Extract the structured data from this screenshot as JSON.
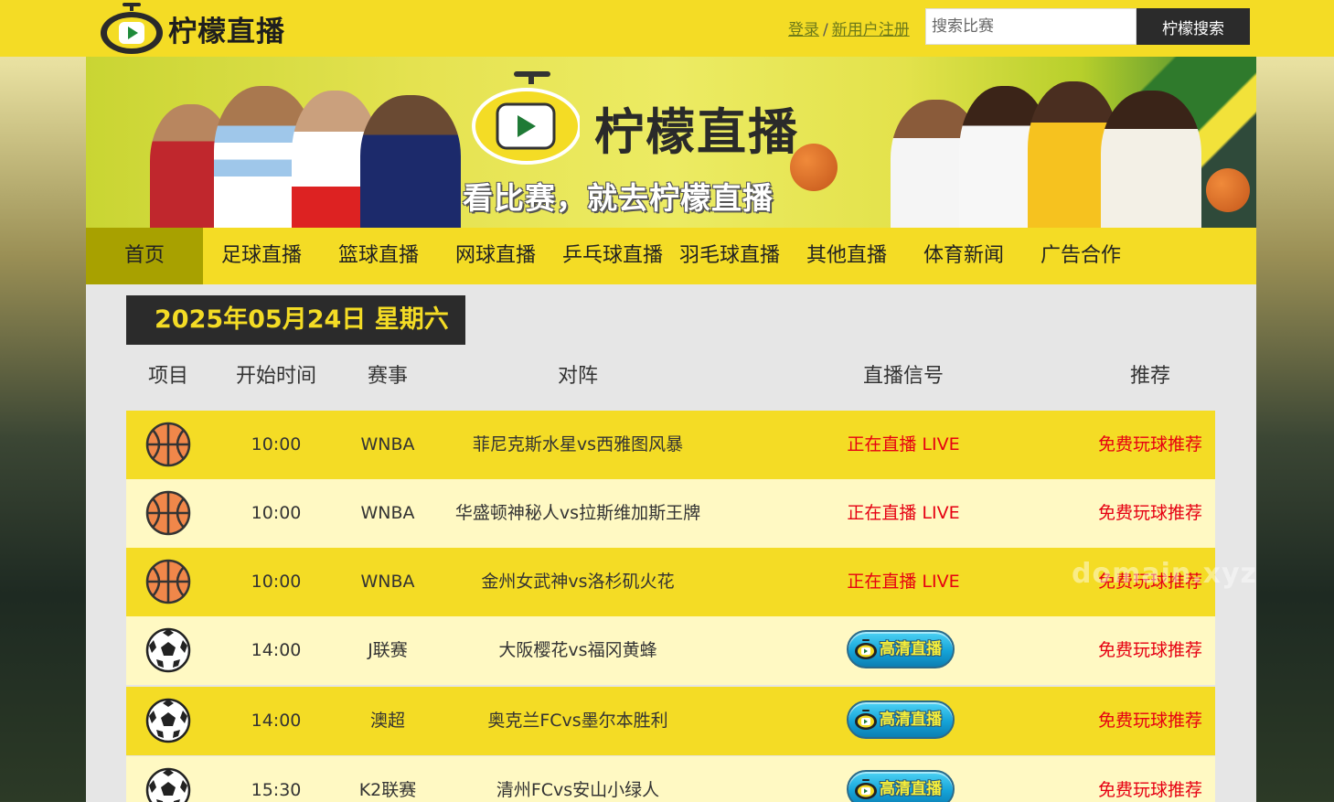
{
  "header": {
    "logo_text": "柠檬直播",
    "login_label": "登录",
    "separator": "/",
    "register_label": "新用户注册",
    "search_placeholder": "搜索比赛",
    "search_button": "柠檬搜索"
  },
  "banner": {
    "title": "柠檬直播",
    "slogan": "看比赛，就去柠檬直播"
  },
  "nav": {
    "items": [
      {
        "label": "首页",
        "active": true
      },
      {
        "label": "足球直播"
      },
      {
        "label": "篮球直播"
      },
      {
        "label": "网球直播"
      },
      {
        "label": "乒乓球直播"
      },
      {
        "label": "羽毛球直播"
      },
      {
        "label": "其他直播"
      },
      {
        "label": "体育新闻"
      },
      {
        "label": "广告合作"
      }
    ]
  },
  "schedule": {
    "date": "2025年05月24日 星期六",
    "columns": [
      "项目",
      "开始时间",
      "赛事",
      "对阵",
      "直播信号",
      "推荐"
    ],
    "rows": [
      {
        "sport": "basketball-icon",
        "time": "10:00",
        "league": "WNBA",
        "match": "菲尼克斯水星vs西雅图风暴",
        "signal": "正在直播 LIVE",
        "signal_type": "live",
        "rec": "免费玩球推荐"
      },
      {
        "sport": "basketball-icon",
        "time": "10:00",
        "league": "WNBA",
        "match": "华盛顿神秘人vs拉斯维加斯王牌",
        "signal": "正在直播 LIVE",
        "signal_type": "live",
        "rec": "免费玩球推荐"
      },
      {
        "sport": "basketball-icon",
        "time": "10:00",
        "league": "WNBA",
        "match": "金州女武神vs洛杉矶火花",
        "signal": "正在直播 LIVE",
        "signal_type": "live",
        "rec": "免费玩球推荐"
      },
      {
        "sport": "soccer-ball-icon",
        "time": "14:00",
        "league": "J联赛",
        "match": "大阪樱花vs福冈黄蜂",
        "signal": "高清直播",
        "signal_type": "hd",
        "rec": "免费玩球推荐"
      },
      {
        "sport": "soccer-ball-icon",
        "time": "14:00",
        "league": "澳超",
        "match": "奥克兰FCvs墨尔本胜利",
        "signal": "高清直播",
        "signal_type": "hd",
        "rec": "免费玩球推荐"
      },
      {
        "sport": "soccer-ball-icon",
        "time": "15:30",
        "league": "K2联赛",
        "match": "清州FCvs安山小绿人",
        "signal": "高清直播",
        "signal_type": "hd",
        "rec": "免费玩球推荐"
      }
    ]
  },
  "watermark": "domain.xyz",
  "colors": {
    "brand_yellow": "#f4dc25",
    "dark": "#2b2b2b",
    "live_red": "#e60012",
    "nav_active": "#a8a100"
  }
}
